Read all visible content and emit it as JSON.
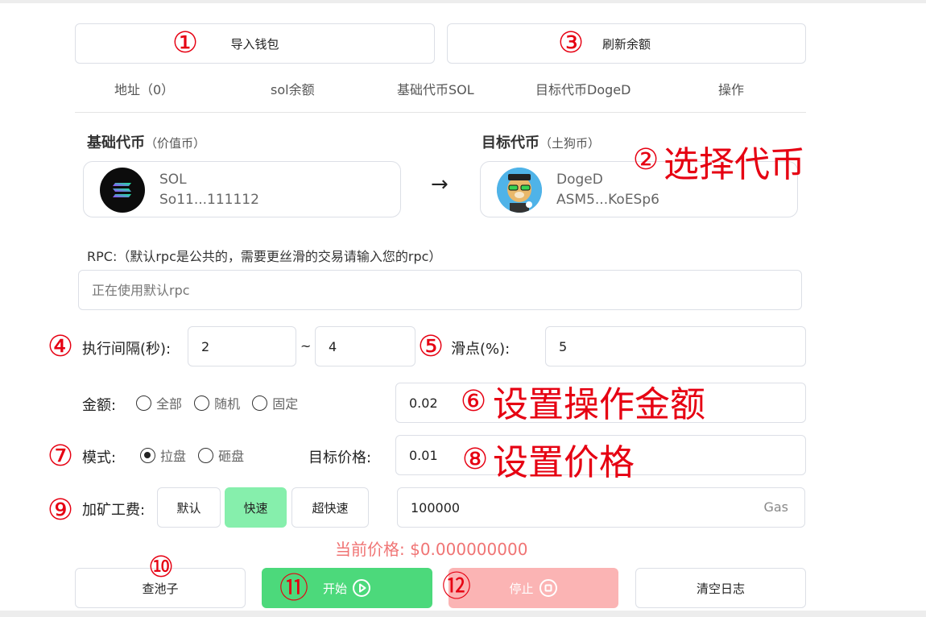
{
  "buttons": {
    "import_wallet": "导入钱包",
    "refresh_balance": "刷新余额"
  },
  "table_headers": [
    "地址（0）",
    "sol余额",
    "基础代币SOL",
    "目标代币DogeD",
    "操作"
  ],
  "base_token": {
    "title": "基础代币",
    "subtitle": "（价值币）",
    "name": "SOL",
    "address": "So11...111112"
  },
  "target_token": {
    "title": "目标代币",
    "subtitle": "（土狗币）",
    "name": "DogeD",
    "address": "ASM5...KoESp6"
  },
  "arrow": "→",
  "rpc": {
    "label": "RPC:（默认rpc是公共的，需要更丝滑的交易请输入您的rpc）",
    "placeholder": "正在使用默认rpc"
  },
  "interval": {
    "label": "执行间隔(秒):",
    "min": "2",
    "separator": "~",
    "max": "4"
  },
  "slippage": {
    "label": "滑点(%):",
    "value": "5"
  },
  "amount": {
    "label": "金额:",
    "options": [
      "全部",
      "随机",
      "固定"
    ],
    "value": "0.02"
  },
  "mode": {
    "label": "模式:",
    "options": [
      "拉盘",
      "砸盘"
    ],
    "selected": "拉盘"
  },
  "target_price": {
    "label": "目标价格:",
    "value": "0.01"
  },
  "fee": {
    "label": "加矿工费:",
    "options": [
      "默认",
      "快速",
      "超快速"
    ],
    "selected": "快速",
    "value": "100000",
    "unit": "Gas"
  },
  "current_price": "当前价格: $0.000000000",
  "actions": {
    "check_pool": "查池子",
    "start": "开始",
    "stop": "停止",
    "clear_log": "清空日志"
  },
  "annotations": {
    "n1": "①",
    "n2": "②",
    "n3": "③",
    "n4": "④",
    "n5": "⑤",
    "n6": "⑥",
    "n7": "⑦",
    "n8": "⑧",
    "n9": "⑨",
    "n10": "⑩",
    "n11": "⑪",
    "n12": "⑫",
    "t2": "选择代币",
    "t6": "设置操作金额",
    "t8": "设置价格"
  },
  "colors": {
    "start_green": "#4cd97b",
    "stop_pink": "#fbb4b4",
    "fee_selected": "#86efac",
    "price_red": "#f07474",
    "annotation_red": "#e60012"
  }
}
